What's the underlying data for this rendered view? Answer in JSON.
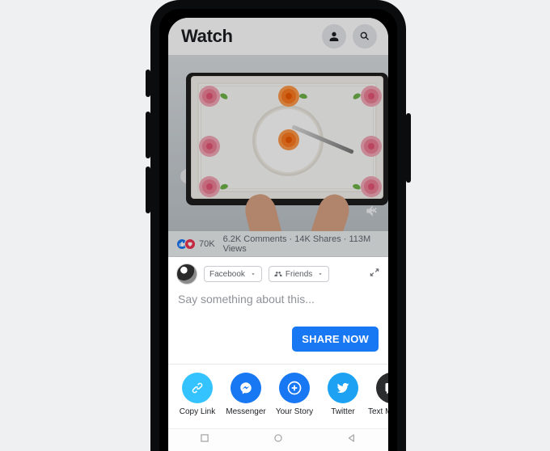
{
  "header": {
    "title": "Watch"
  },
  "video": {
    "reactions_count": "70K",
    "stats_text": "6.2K Comments · 14K Shares · 113M Views"
  },
  "share_sheet": {
    "destination_label": "Facebook",
    "audience_label": "Friends",
    "compose_placeholder": "Say something about this...",
    "share_button": "SHARE NOW",
    "targets": [
      {
        "id": "copy",
        "label": "Copy Link"
      },
      {
        "id": "msgr",
        "label": "Messenger"
      },
      {
        "id": "story",
        "label": "Your Story"
      },
      {
        "id": "tw",
        "label": "Twitter"
      },
      {
        "id": "text",
        "label": "Text Message"
      }
    ]
  }
}
